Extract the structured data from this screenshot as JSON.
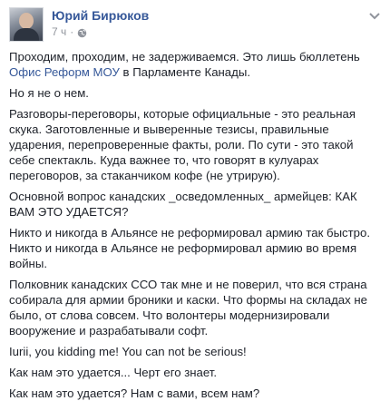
{
  "post": {
    "author": "Юрий Бирюков",
    "time": "7 ч",
    "separator": "·",
    "p1": {
      "before": "Проходим, проходим, не задерживаемся. Это лишь бюллетень ",
      "link": "Офис Реформ МОУ",
      "after": " в Парламенте Канады."
    },
    "p2": "Но я не о нем.",
    "p3": "Разговоры-переговоры, которые официальные - это реальная скука. Заготовленные и выверенные тезисы, правильные ударения, перепроверенные факты, роли. По сути - это такой себе спектакль. Куда важнее то, что говорят в кулуарах переговоров, за стаканчиком кофе (не утрирую).",
    "p4": "Основной вопрос канадских _осведомленных_ армейцев: КАК ВАМ ЭТО УДАЕТСЯ?",
    "p5": "Никто и никогда в Альянсе не реформировал армию так быстро. Никто и никогда в Альянсе не реформировал армию во время войны.",
    "p6": "Полковник канадских ССО так мне и не поверил, что вся страна собирала для армии броники и каски. Что формы на складах не было, от слова совсем. Что волонтеры модернизировали вооружение и разрабатывали софт.",
    "p7": "Iurii, you kidding me! You can not be serious!",
    "p8": "Как нам это удается... Черт его знает.",
    "p9": "Как нам это удается? Нам с вами, всем нам?"
  },
  "colors": {
    "link": "#365899",
    "text": "#1d2129",
    "meta": "#90949c"
  },
  "icons": {
    "privacy": "globe-icon",
    "menu": "chevron-down-icon"
  }
}
